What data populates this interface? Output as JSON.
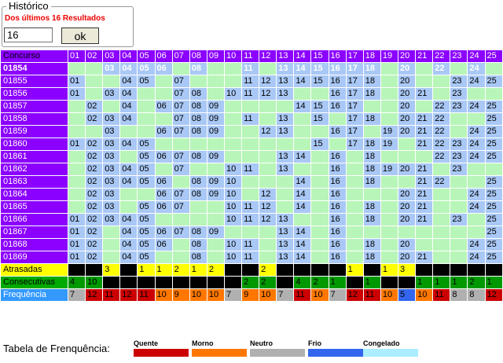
{
  "historico": {
    "legend": "Histórico",
    "subtitle": "Dos últimos 16 Resultados",
    "input_value": "16",
    "ok_label": "ok"
  },
  "table": {
    "header_label": "Concurso",
    "columns": [
      "01",
      "02",
      "03",
      "04",
      "05",
      "06",
      "07",
      "08",
      "09",
      "10",
      "11",
      "12",
      "13",
      "14",
      "15",
      "16",
      "17",
      "18",
      "19",
      "20",
      "21",
      "22",
      "23",
      "24",
      "25"
    ],
    "rows": [
      {
        "id": "01854",
        "nums": [
          3,
          4,
          5,
          6,
          8,
          11,
          13,
          14,
          15,
          16,
          17,
          18,
          20,
          22,
          24
        ]
      },
      {
        "id": "01855",
        "nums": [
          1,
          4,
          5,
          7,
          11,
          12,
          13,
          14,
          15,
          16,
          17,
          18,
          20,
          23,
          24,
          25
        ]
      },
      {
        "id": "01856",
        "nums": [
          1,
          3,
          4,
          7,
          8,
          10,
          11,
          12,
          13,
          16,
          17,
          18,
          20,
          21,
          23
        ]
      },
      {
        "id": "01857",
        "nums": [
          2,
          4,
          6,
          7,
          8,
          9,
          14,
          15,
          16,
          17,
          20,
          22,
          23,
          24,
          25
        ]
      },
      {
        "id": "01858",
        "nums": [
          2,
          3,
          4,
          7,
          8,
          9,
          11,
          13,
          15,
          17,
          18,
          20,
          21,
          22,
          25
        ]
      },
      {
        "id": "01859",
        "nums": [
          3,
          6,
          7,
          8,
          9,
          12,
          13,
          16,
          17,
          19,
          20,
          21,
          22,
          24,
          25
        ]
      },
      {
        "id": "01860",
        "nums": [
          1,
          2,
          3,
          4,
          5,
          15,
          17,
          18,
          19,
          21,
          22,
          23,
          24,
          25
        ]
      },
      {
        "id": "01861",
        "nums": [
          2,
          3,
          5,
          6,
          7,
          8,
          9,
          13,
          14,
          16,
          18,
          22,
          23,
          24,
          25
        ]
      },
      {
        "id": "01862",
        "nums": [
          2,
          3,
          4,
          5,
          7,
          10,
          11,
          13,
          16,
          18,
          19,
          20,
          21,
          23
        ]
      },
      {
        "id": "01863",
        "nums": [
          2,
          3,
          4,
          5,
          6,
          8,
          9,
          10,
          14,
          16,
          18,
          21,
          22,
          25
        ]
      },
      {
        "id": "01864",
        "nums": [
          2,
          3,
          6,
          7,
          8,
          9,
          10,
          12,
          14,
          16,
          20,
          21,
          24,
          25
        ]
      },
      {
        "id": "01865",
        "nums": [
          2,
          3,
          5,
          6,
          7,
          10,
          11,
          12,
          14,
          16,
          18,
          20,
          21,
          24,
          25
        ]
      },
      {
        "id": "01866",
        "nums": [
          1,
          2,
          3,
          4,
          5,
          10,
          11,
          12,
          13,
          16,
          18,
          20,
          21,
          23,
          25
        ]
      },
      {
        "id": "01867",
        "nums": [
          1,
          2,
          4,
          5,
          6,
          7,
          8,
          9,
          13,
          14,
          16,
          25
        ]
      },
      {
        "id": "01868",
        "nums": [
          1,
          2,
          4,
          5,
          6,
          8,
          10,
          11,
          13,
          14,
          16,
          18,
          20,
          24,
          25
        ]
      },
      {
        "id": "01869",
        "nums": [
          1,
          2,
          4,
          5,
          8,
          10,
          11,
          13,
          14,
          16,
          18,
          20,
          21,
          24,
          25
        ]
      }
    ],
    "atrasadas": {
      "label": "Atrasadas",
      "values": [
        "",
        "",
        "3",
        "",
        "1",
        "1",
        "2",
        "1",
        "2",
        "",
        "",
        "2",
        "",
        "",
        "",
        "",
        "1",
        "",
        "1",
        "3",
        "",
        "",
        "",
        "",
        ""
      ]
    },
    "consecutivas": {
      "label": "Consecutivas",
      "values": [
        "4",
        "10",
        "",
        "",
        "",
        "",
        "",
        "",
        "",
        "",
        "2",
        "2",
        "",
        "4",
        "2",
        "1",
        "",
        "1",
        "",
        "",
        "1",
        "1",
        "1",
        "2",
        "1"
      ]
    },
    "frequencia": {
      "label": "Frequência",
      "values": [
        "7",
        "12",
        "11",
        "12",
        "11",
        "10",
        "9",
        "10",
        "10",
        "7",
        "9",
        "10",
        "7",
        "11",
        "10",
        "7",
        "12",
        "11",
        "10",
        "5",
        "10",
        "11",
        "8",
        "8",
        "12"
      ],
      "levels": [
        "neutro",
        "quente",
        "quente",
        "quente",
        "quente",
        "morno",
        "morno",
        "morno",
        "morno",
        "neutro",
        "morno",
        "morno",
        "neutro",
        "quente",
        "morno",
        "neutro",
        "quente",
        "quente",
        "morno",
        "frio",
        "morno",
        "quente",
        "neutro",
        "neutro",
        "quente"
      ]
    }
  },
  "legend": {
    "title": "Tabela de Frenquência:",
    "items": [
      {
        "name": "Quente",
        "color": "#cc0000"
      },
      {
        "name": "Morno",
        "color": "#ff7700"
      },
      {
        "name": "Neutro",
        "color": "#b0b0b0"
      },
      {
        "name": "Frio",
        "color": "#3366ee"
      },
      {
        "name": "Congelado",
        "color": "#aaeeff"
      }
    ]
  },
  "colors": {
    "quente": "#cc0000",
    "morno": "#ff7700",
    "neutro": "#b0b0b0",
    "frio": "#3366ee",
    "congelado": "#aaeeff"
  }
}
